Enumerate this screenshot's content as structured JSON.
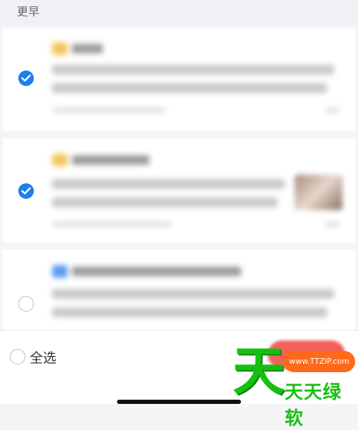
{
  "section": {
    "title": "更早"
  },
  "messages": [
    {
      "selected": true,
      "tag_color": "#f5c55a",
      "has_thumbnail": false
    },
    {
      "selected": true,
      "tag_color": "#f5c55a",
      "has_thumbnail": true
    },
    {
      "selected": false,
      "tag_color": "#5b9cf0",
      "has_thumbnail": false
    }
  ],
  "bottom": {
    "select_all_label": "全选",
    "delete_label": ""
  },
  "watermark": {
    "char": "天",
    "url": "www.TTZIP.com",
    "name": "天天绿软"
  },
  "colors": {
    "accent": "#1a7ff0",
    "delete": "#f3605a",
    "watermark_green": "#16c012",
    "watermark_orange": "#ff6a1a"
  }
}
